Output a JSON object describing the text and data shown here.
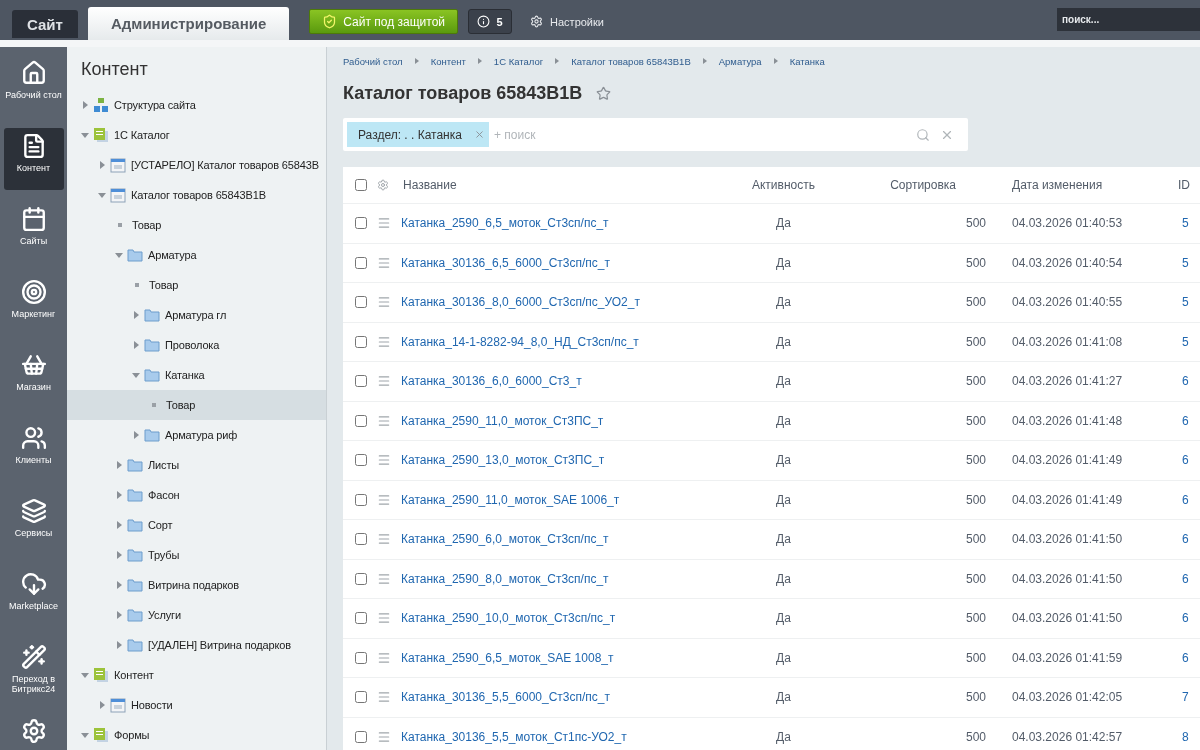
{
  "top_bar": {
    "tabs": [
      {
        "label": "Сайт",
        "selected": false
      },
      {
        "label": "Администрирование",
        "selected": true
      }
    ],
    "security_button": "Сайт под защитой",
    "notifications": "5",
    "settings": "Настройки",
    "search": {
      "placeholder": "поиск..."
    }
  },
  "rail": [
    {
      "label": "Рабочий стол",
      "selected": false
    },
    {
      "label": "Контент",
      "selected": true
    },
    {
      "label": "Сайты",
      "selected": false
    },
    {
      "label": "Маркетинг",
      "selected": false
    },
    {
      "label": "Магазин",
      "selected": false
    },
    {
      "label": "Клиенты",
      "selected": false
    },
    {
      "label": "Сервисы",
      "selected": false
    },
    {
      "label": "Marketplace",
      "selected": false
    },
    {
      "label": "Переход в Битрикс24",
      "selected": false
    },
    {
      "selected": false
    }
  ],
  "tree": {
    "title": "Контент",
    "items": [
      {
        "kind": "site",
        "label": "Структура сайта",
        "expanded": false,
        "selected": false
      },
      {
        "kind": "catalog",
        "label": "1С Каталог",
        "expanded": true,
        "selected": false,
        "children": [
          {
            "kind": "iblock",
            "label": "[УСТАРЕЛО] Каталог товаров 65843В",
            "expanded": false,
            "selected": false
          },
          {
            "kind": "iblock",
            "label": "Каталог товаров 65843В1В",
            "expanded": true,
            "selected": false,
            "children": [
              {
                "kind": "item",
                "label": "Товар",
                "selected": false
              },
              {
                "kind": "folder",
                "label": "Арматура",
                "expanded": true,
                "selected": false,
                "children": [
                  {
                    "kind": "item",
                    "label": "Товар",
                    "selected": false
                  },
                  {
                    "kind": "folder",
                    "label": "Арматура гл",
                    "expanded": false,
                    "selected": false
                  },
                  {
                    "kind": "folder",
                    "label": "Проволока",
                    "expanded": false,
                    "selected": false
                  },
                  {
                    "kind": "folder",
                    "label": "Катанка",
                    "expanded": true,
                    "selected": false,
                    "children": [
                      {
                        "kind": "item",
                        "label": "Товар",
                        "selected": true
                      }
                    ]
                  },
                  {
                    "kind": "folder",
                    "label": "Арматура риф",
                    "expanded": false,
                    "selected": false
                  }
                ]
              },
              {
                "kind": "folder",
                "label": "Листы",
                "expanded": false,
                "selected": false
              },
              {
                "kind": "folder",
                "label": "Фасон",
                "expanded": false,
                "selected": false
              },
              {
                "kind": "folder",
                "label": "Сорт",
                "expanded": false,
                "selected": false
              },
              {
                "kind": "folder",
                "label": "Трубы",
                "expanded": false,
                "selected": false
              },
              {
                "kind": "folder",
                "label": "Витрина подарков",
                "expanded": false,
                "selected": false
              },
              {
                "kind": "folder",
                "label": "Услуги",
                "expanded": false,
                "selected": false
              },
              {
                "kind": "folder",
                "label": "[УДАЛЕН] Витрина подарков",
                "expanded": false,
                "selected": false
              }
            ]
          }
        ]
      },
      {
        "kind": "catalog",
        "label": "Контент",
        "expanded": true,
        "selected": false,
        "children": [
          {
            "kind": "iblock",
            "label": "Новости",
            "expanded": false,
            "selected": false
          }
        ]
      },
      {
        "kind": "catalog",
        "label": "Формы",
        "expanded": true,
        "selected": false
      }
    ]
  },
  "breadcrumbs": [
    "Рабочий стол",
    "Контент",
    "1С Каталог",
    "Каталог товаров 65843В1В",
    "Арматура",
    "Катанка"
  ],
  "title": "Каталог товаров 65843В1В",
  "filter": {
    "chip": "Раздел: . . Катанка",
    "placeholder": "+ поиск"
  },
  "table": {
    "select_all_checked": false,
    "columns": [
      "Название",
      "Активность",
      "Сортировка",
      "Дата изменения",
      "ID"
    ],
    "rows": [
      {
        "checked": false,
        "name": "Катанка_2590_6,5_моток_Ст3сп/пс_т",
        "active": "Да",
        "sort": "500",
        "date": "04.03.2026 01:40:53",
        "id": "5"
      },
      {
        "checked": false,
        "name": "Катанка_30136_6,5_6000_Ст3сп/пс_т",
        "active": "Да",
        "sort": "500",
        "date": "04.03.2026 01:40:54",
        "id": "5"
      },
      {
        "checked": false,
        "name": "Катанка_30136_8,0_6000_Ст3сп/пс_УО2_т",
        "active": "Да",
        "sort": "500",
        "date": "04.03.2026 01:40:55",
        "id": "5"
      },
      {
        "checked": false,
        "name": "Катанка_14-1-8282-94_8,0_НД_Ст3сп/пс_т",
        "active": "Да",
        "sort": "500",
        "date": "04.03.2026 01:41:08",
        "id": "5"
      },
      {
        "checked": false,
        "name": "Катанка_30136_6,0_6000_Ст3_т",
        "active": "Да",
        "sort": "500",
        "date": "04.03.2026 01:41:27",
        "id": "6"
      },
      {
        "checked": false,
        "name": "Катанка_2590_11,0_моток_Ст3ПС_т",
        "active": "Да",
        "sort": "500",
        "date": "04.03.2026 01:41:48",
        "id": "6"
      },
      {
        "checked": false,
        "name": "Катанка_2590_13,0_моток_Ст3ПС_т",
        "active": "Да",
        "sort": "500",
        "date": "04.03.2026 01:41:49",
        "id": "6"
      },
      {
        "checked": false,
        "name": "Катанка_2590_11,0_моток_SAE 1006_т",
        "active": "Да",
        "sort": "500",
        "date": "04.03.2026 01:41:49",
        "id": "6"
      },
      {
        "checked": false,
        "name": "Катанка_2590_6,0_моток_Ст3сп/пс_т",
        "active": "Да",
        "sort": "500",
        "date": "04.03.2026 01:41:50",
        "id": "6"
      },
      {
        "checked": false,
        "name": "Катанка_2590_8,0_моток_Ст3сп/пс_т",
        "active": "Да",
        "sort": "500",
        "date": "04.03.2026 01:41:50",
        "id": "6"
      },
      {
        "checked": false,
        "name": "Катанка_2590_10,0_моток_Ст3сп/пс_т",
        "active": "Да",
        "sort": "500",
        "date": "04.03.2026 01:41:50",
        "id": "6"
      },
      {
        "checked": false,
        "name": "Катанка_2590_6,5_моток_SAE 1008_т",
        "active": "Да",
        "sort": "500",
        "date": "04.03.2026 01:41:59",
        "id": "6"
      },
      {
        "checked": false,
        "name": "Катанка_30136_5,5_6000_Ст3сп/пс_т",
        "active": "Да",
        "sort": "500",
        "date": "04.03.2026 01:42:05",
        "id": "7"
      },
      {
        "checked": false,
        "name": "Катанка_30136_5,5_моток_Ст1пс-УО2_т",
        "active": "Да",
        "sort": "500",
        "date": "04.03.2026 01:42:57",
        "id": "8"
      }
    ]
  }
}
